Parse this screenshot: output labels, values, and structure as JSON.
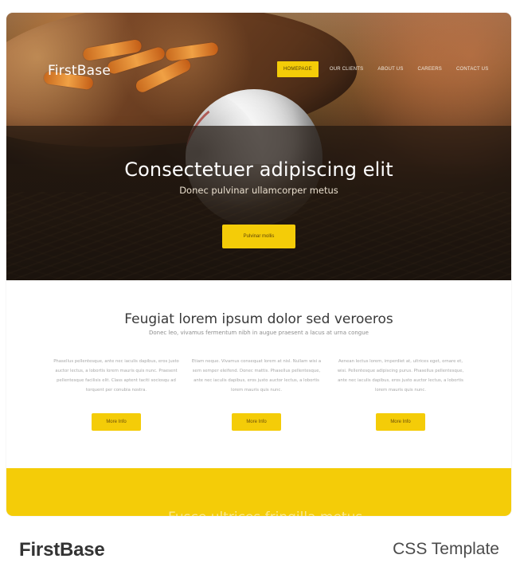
{
  "preview": {
    "brand": "FirstBase",
    "nav": [
      {
        "label": "HOMEPAGE",
        "active": true
      },
      {
        "label": "OUR CLIENTS",
        "active": false
      },
      {
        "label": "ABOUT US",
        "active": false
      },
      {
        "label": "CAREERS",
        "active": false
      },
      {
        "label": "CONTACT US",
        "active": false
      }
    ],
    "hero": {
      "title": "Consectetuer adipiscing elit",
      "subtitle": "Donec pulvinar ullamcorper metus",
      "button": "Pulvinar mollis"
    },
    "section": {
      "title": "Feugiat lorem ipsum dolor sed veroeros",
      "subtitle": "Donec leo, vivamus fermentum nibh in augue praesent a lacus at urna congue"
    },
    "features": [
      {
        "text": "Phasellus pellentesque, ante nec iaculis dapibus, eros justo auctor lectus, a lobortis lorem mauris quis nunc. Praesent pellentesque facilisis elit. Class aptent taciti sociosqu ad torquent per conubia nostra.",
        "button": "More Info"
      },
      {
        "text": "Etiam neque. Vivamus consequat lorem at nisl. Nullam wisi a sem semper eleifend. Donec mattis. Phasellus pellentesque, ante nec iaculis dapibus, eros justo auctor lectus, a lobortis lorem mauris quis nunc.",
        "button": "More Info"
      },
      {
        "text": "Aenean lectus lorem, imperdiet at, ultrices eget, ornare et, wisi. Pellentesque adipiscing purus. Phasellus pellentesque, ante nec iaculis dapibus, eros justo auctor lectus, a lobortis lorem mauris quis nunc.",
        "button": "More Info"
      }
    ],
    "footer_partial": "Fusce ultrices fringilla metus"
  },
  "meta": {
    "name": "FirstBase",
    "type": "CSS Template"
  },
  "colors": {
    "accent": "#f4cc08",
    "title_text": "#333333",
    "secondary_text": "#4b4b4b",
    "hero_overlay": "#211710"
  },
  "icons": {
    "hero_visual": "baseball-and-glove-icon"
  }
}
